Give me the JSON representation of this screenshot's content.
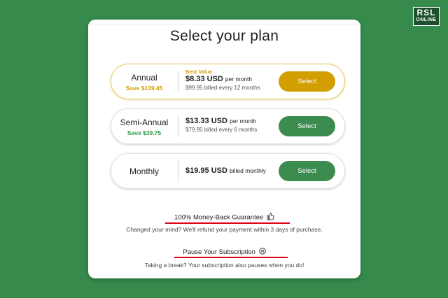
{
  "logo": {
    "line1": "RSL",
    "line2": "ONLINE"
  },
  "title": "Select your plan",
  "colors": {
    "background": "#358a4c",
    "gold": "#d39e00",
    "green": "#3d8c4f",
    "save_green": "#2e9a48",
    "underline": "#e0001a"
  },
  "plans": [
    {
      "name": "Annual",
      "save": "Save $139.45",
      "badge": "Best Value",
      "price": "$8.33 USD",
      "per": "per month",
      "billed": "$99.95 billed every 12 months",
      "button": "Select"
    },
    {
      "name": "Semi-Annual",
      "save": "Save $39.75",
      "price": "$13.33 USD",
      "per": "per month",
      "billed": "$79.95 billed every 6 months",
      "button": "Select"
    },
    {
      "name": "Monthly",
      "price": "$19.95 USD",
      "per": "billed monthly",
      "button": "Select"
    }
  ],
  "guarantee": {
    "title": "100% Money-Back Guarantee",
    "icon": "thumbs-up-icon",
    "text": "Changed your mind? We'll refund your payment within 3 days of purchase."
  },
  "pause": {
    "title": "Pause Your Subscription",
    "icon": "pause-icon",
    "text": "Taking a break? Your subscription also pauses when you do!"
  }
}
